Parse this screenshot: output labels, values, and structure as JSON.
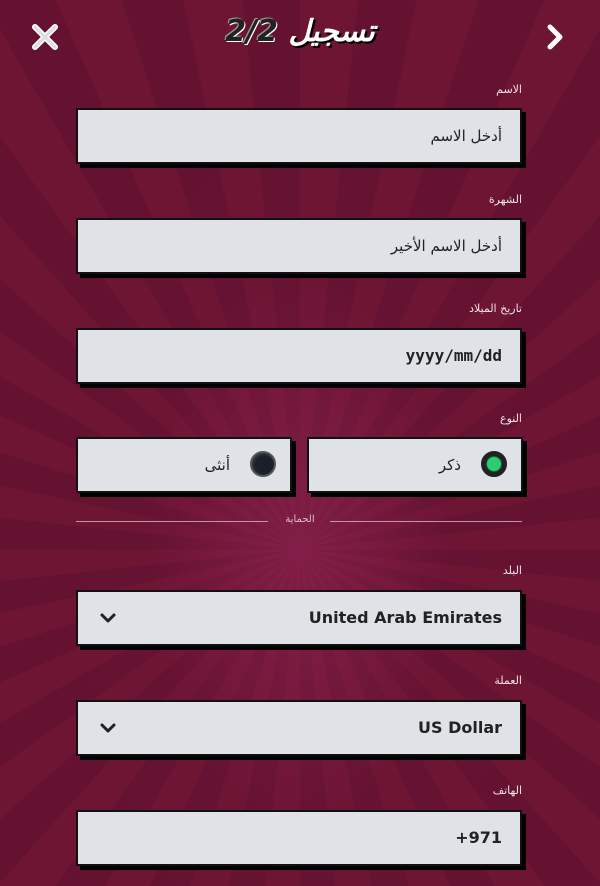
{
  "header": {
    "title": "تسجيل",
    "step": "2/2"
  },
  "fields": {
    "first_name": {
      "label": "الاسم",
      "placeholder": "أدخل الاسم"
    },
    "last_name": {
      "label": "الشهرة",
      "placeholder": "أدخل الاسم الأخير"
    },
    "birthdate": {
      "label": "تاريخ الميلاد",
      "placeholder": "yyyy/mm/dd"
    },
    "gender": {
      "label": "النوع",
      "male": "ذكر",
      "female": "أنثى",
      "selected": "male"
    },
    "section_divider": "الحماية",
    "country": {
      "label": "البلد",
      "value": "United Arab Emirates"
    },
    "currency": {
      "label": "العملة",
      "value": "US Dollar"
    },
    "phone": {
      "label": "الهاتف",
      "value": "+971"
    }
  },
  "colors": {
    "background": "#6a1432",
    "field_bg": "#dfe2e6",
    "radio_selected": "#2ecc71"
  },
  "icons": {
    "close": "close-icon",
    "back": "chevron-right-icon",
    "dropdown": "chevron-down-icon"
  }
}
